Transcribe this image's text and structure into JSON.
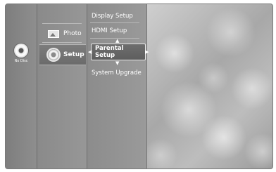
{
  "disc_status": {
    "label": "No Disc"
  },
  "main_menu": {
    "items": [
      {
        "label": "Photo",
        "icon": "photo-icon"
      },
      {
        "label": "Setup",
        "icon": "gear-icon",
        "selected": true
      }
    ]
  },
  "sub_menu": {
    "items": [
      {
        "label": "Display Setup"
      },
      {
        "label": "HDMI Setup"
      },
      {
        "label": "Parental Setup",
        "selected": true
      },
      {
        "label": "System Upgrade"
      }
    ]
  }
}
